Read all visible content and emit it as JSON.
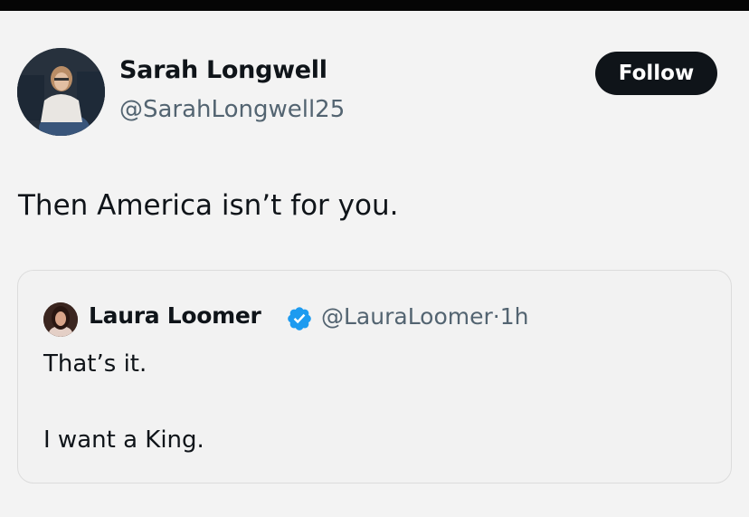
{
  "post": {
    "author_name": "Sarah Longwell",
    "author_handle": "@SarahLongwell25",
    "follow_label": "Follow",
    "text": "Then America isn’t for you."
  },
  "quoted_post": {
    "author_name": "Laura Loomer",
    "author_handle": "@LauraLoomer",
    "separator": "·",
    "time": "1h",
    "line1": "That’s it.",
    "line2": "I want a King.",
    "verified_icon": "verified-badge-icon"
  },
  "colors": {
    "text_primary": "#0f1419",
    "text_secondary": "#536471",
    "follow_button_bg": "#0f1419",
    "verified_blue": "#1d9bf0"
  }
}
